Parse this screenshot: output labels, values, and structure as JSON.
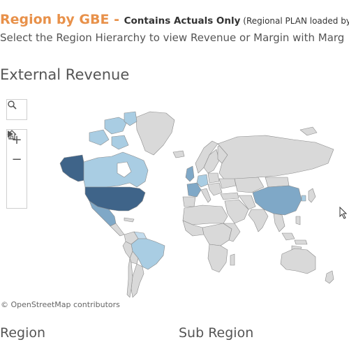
{
  "header": {
    "title_main": "Region by GBE - ",
    "title_sub": "Contains Actuals Only",
    "title_note": " (Regional PLAN loaded by",
    "instruction": "Select the Region Hierarchy to view Revenue or Margin with Marg"
  },
  "section_title": "External Revenue",
  "map": {
    "attribution": "© OpenStreetMap contributors",
    "tools": {
      "search": "search-icon",
      "zoom_in": "+",
      "zoom_out": "−",
      "home": "home-icon",
      "pan": "play-icon"
    },
    "colors": {
      "no_data": "#d9d9d9",
      "border": "#8a8a8a",
      "darkest": "#3f6489",
      "dark": "#4a6d90",
      "mid": "#7fa8c7",
      "light": "#a9cde3",
      "lightest": "#c3dced"
    }
  },
  "filters": {
    "region_label": "Region",
    "sub_region_label": "Sub Region"
  }
}
